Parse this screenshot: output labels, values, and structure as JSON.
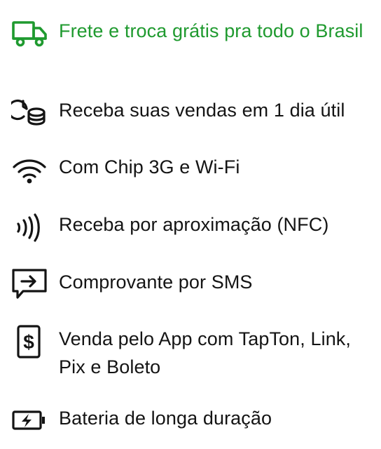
{
  "features": [
    {
      "label": "Frete e troca grátis pra todo o Brasil",
      "icon": "truck-icon",
      "highlight": true,
      "color": "#1f9a2f"
    },
    {
      "label": "Receba suas vendas em 1 dia útil",
      "icon": "clock-coins-icon",
      "highlight": false
    },
    {
      "label": "Com Chip 3G e Wi-Fi",
      "icon": "wifi-icon",
      "highlight": false
    },
    {
      "label": "Receba por aproximação (NFC)",
      "icon": "nfc-icon",
      "highlight": false
    },
    {
      "label": "Comprovante por SMS",
      "icon": "sms-icon",
      "highlight": false
    },
    {
      "label": "Venda pelo App com TapTon, Link, Pix e Boleto",
      "icon": "dollar-phone-icon",
      "highlight": false
    },
    {
      "label": "Bateria de longa duração",
      "icon": "battery-icon",
      "highlight": false
    }
  ],
  "colors": {
    "text": "#141414",
    "accent": "#1f9a2f"
  }
}
